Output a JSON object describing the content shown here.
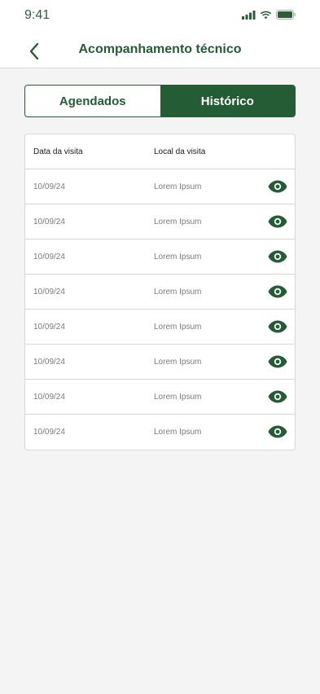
{
  "status_bar": {
    "time": "9:41"
  },
  "header": {
    "title": "Acompanhamento técnico"
  },
  "tabs": [
    {
      "label": "Agendados",
      "active": false
    },
    {
      "label": "Histórico",
      "active": true
    }
  ],
  "table": {
    "headers": {
      "date": "Data da visita",
      "place": "Local da visita"
    },
    "rows": [
      {
        "date": "10/09/24",
        "place": "Lorem Ipsum"
      },
      {
        "date": "10/09/24",
        "place": "Lorem Ipsum"
      },
      {
        "date": "10/09/24",
        "place": "Lorem Ipsum"
      },
      {
        "date": "10/09/24",
        "place": "Lorem Ipsum"
      },
      {
        "date": "10/09/24",
        "place": "Lorem Ipsum"
      },
      {
        "date": "10/09/24",
        "place": "Lorem Ipsum"
      },
      {
        "date": "10/09/24",
        "place": "Lorem Ipsum"
      },
      {
        "date": "10/09/24",
        "place": "Lorem Ipsum"
      }
    ],
    "row_action_icon": "eye-icon"
  },
  "colors": {
    "primary": "#235c35",
    "background": "#f4f4f4",
    "border": "#d8d8d8"
  }
}
